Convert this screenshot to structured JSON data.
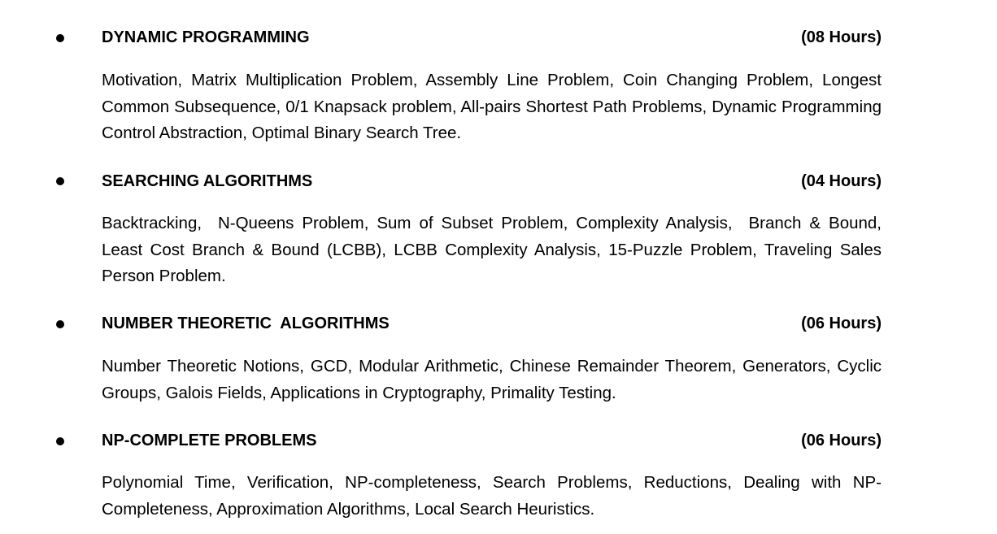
{
  "sections": [
    {
      "title": "DYNAMIC PROGRAMMING",
      "hours": "(08 Hours)",
      "content": "Motivation, Matrix Multiplication Problem, Assembly Line Problem, Coin Changing Problem, Longest Common Subsequence, 0/1 Knapsack problem, All-pairs Shortest Path Problems, Dynamic Programming Control Abstraction, Optimal Binary Search Tree."
    },
    {
      "title": "SEARCHING ALGORITHMS",
      "hours": "(04 Hours)",
      "content": "Backtracking,  N-Queens Problem, Sum of Subset Problem, Complexity Analysis,  Branch & Bound,  Least Cost Branch & Bound (LCBB), LCBB Complexity Analysis, 15-Puzzle Problem, Traveling Sales Person Problem."
    },
    {
      "title": "NUMBER THEORETIC  ALGORITHMS",
      "hours": "(06 Hours)",
      "content": "Number Theoretic Notions, GCD, Modular Arithmetic, Chinese Remainder Theorem, Generators, Cyclic Groups, Galois Fields, Applications in Cryptography, Primality Testing."
    },
    {
      "title": "NP-COMPLETE PROBLEMS",
      "hours": "(06 Hours)",
      "content": "Polynomial Time, Verification, NP-completeness, Search Problems, Reductions, Dealing with NP-Completeness, Approximation Algorithms, Local Search Heuristics."
    }
  ]
}
